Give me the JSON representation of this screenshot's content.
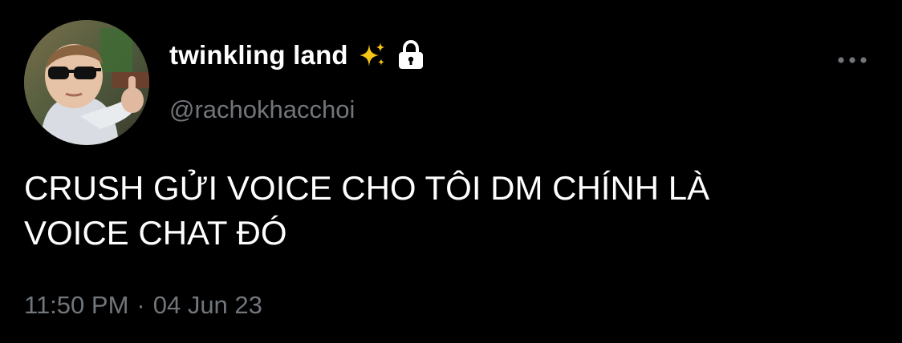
{
  "tweet": {
    "author": {
      "display_name": "twinkling land",
      "handle": "@rachokhacchoi",
      "emoji_icon": "sparkles-icon",
      "protected_icon": "lock-icon",
      "avatar_description_icon": "avatar"
    },
    "more_icon": "more-horizontal-icon",
    "text": "CRUSH GỬI VOICE CHO TÔI DM CHÍNH LÀ\nVOICE CHAT ĐÓ",
    "time": "11:50 PM",
    "separator": "·",
    "date": "04 Jun 23"
  },
  "colors": {
    "background": "#000000",
    "primary_text": "#ffffff",
    "secondary_text": "#71767b",
    "sparkle_yellow": "#f5c518"
  }
}
